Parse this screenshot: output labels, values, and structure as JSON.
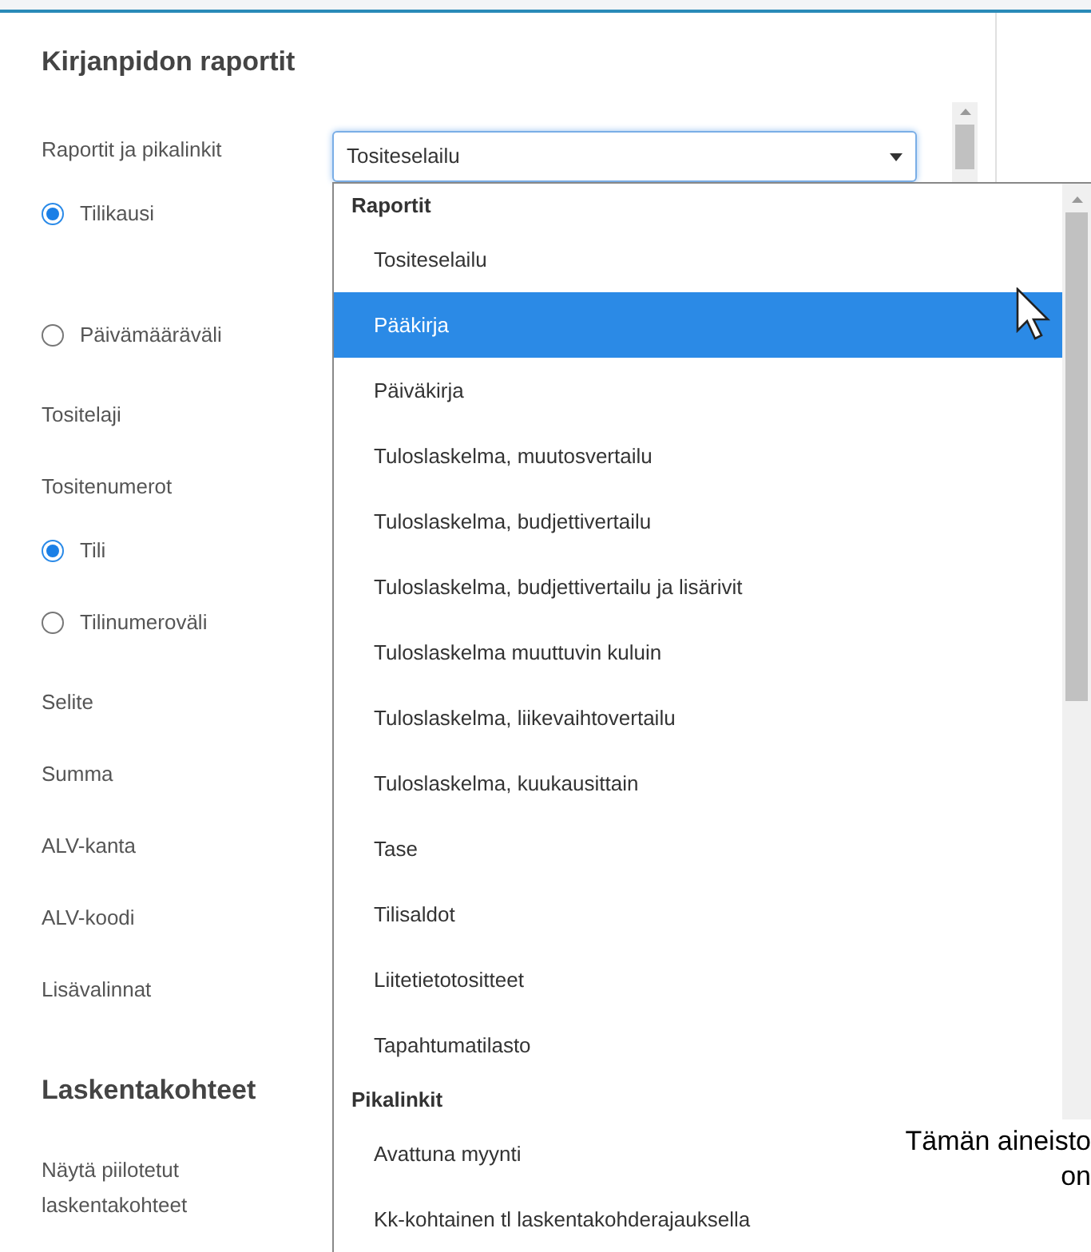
{
  "title": "Kirjanpidon raportit",
  "form": [
    {
      "kind": "label",
      "text": "Raportit ja pikalinkit"
    },
    {
      "kind": "radio",
      "text": "Tilikausi",
      "selected": true
    },
    {
      "kind": "radio",
      "text": "Päivämääräväli",
      "selected": false
    },
    {
      "kind": "label",
      "text": "Tositelaji"
    },
    {
      "kind": "label",
      "text": "Tositenumerot"
    },
    {
      "kind": "radio",
      "text": "Tili",
      "selected": true
    },
    {
      "kind": "radio",
      "text": "Tilinumeroväli",
      "selected": false
    },
    {
      "kind": "label",
      "text": "Selite"
    },
    {
      "kind": "label",
      "text": "Summa"
    },
    {
      "kind": "label",
      "text": "ALV-kanta"
    },
    {
      "kind": "label",
      "text": "ALV-koodi"
    },
    {
      "kind": "label",
      "text": "Lisävalinnat"
    },
    {
      "kind": "heading",
      "text": "Laskentakohteet"
    },
    {
      "kind": "label",
      "text": "Näytä piilotetut laskentakohteet"
    }
  ],
  "select": {
    "value": "Tositeselailu"
  },
  "dropdown": [
    {
      "group": "Raportit",
      "items": [
        {
          "label": "Tositeselailu",
          "selected": false
        },
        {
          "label": "Pääkirja",
          "selected": true
        },
        {
          "label": "Päiväkirja",
          "selected": false
        },
        {
          "label": "Tuloslaskelma, muutosvertailu",
          "selected": false
        },
        {
          "label": "Tuloslaskelma, budjettivertailu",
          "selected": false
        },
        {
          "label": "Tuloslaskelma, budjettivertailu ja lisärivit",
          "selected": false
        },
        {
          "label": "Tuloslaskelma muuttuvin kuluin",
          "selected": false
        },
        {
          "label": "Tuloslaskelma, liikevaihtovertailu",
          "selected": false
        },
        {
          "label": "Tuloslaskelma, kuukausittain",
          "selected": false
        },
        {
          "label": "Tase",
          "selected": false
        },
        {
          "label": "Tilisaldot",
          "selected": false
        },
        {
          "label": "Liitetietotositteet",
          "selected": false
        },
        {
          "label": "Tapahtumatilasto",
          "selected": false
        }
      ]
    },
    {
      "group": "Pikalinkit",
      "items": [
        {
          "label": "Avattuna myynti",
          "selected": false
        },
        {
          "label": "Kk-kohtainen tl laskentakohderajauksella",
          "selected": false
        }
      ]
    }
  ],
  "notice": [
    "Tämän aineisto",
    "on"
  ]
}
